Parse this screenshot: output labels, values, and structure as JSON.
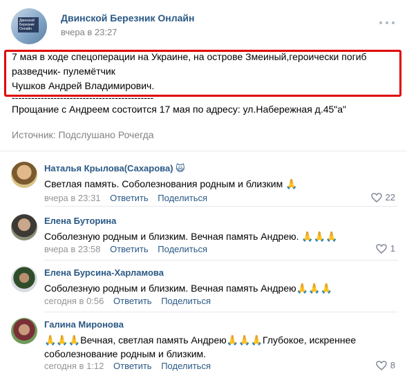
{
  "post": {
    "group_name": "Двинской Березник Онлайн",
    "time": "вчера в 23:27",
    "avatar_text": "Двинской Березник Онлайн",
    "line1": "7 мая в ходе спецоперации на Украине, на острове Змеиный,героически погиб",
    "line2": "разведчик- пулемётчик",
    "line3": "Чушков Андрей Владимирович.",
    "line4": "--------------------------------------------",
    "line5": "Прощание с Андреем состоится 17 мая по адресу: ул.Набережная д.45\"а\"",
    "source": "Источник: Подслушано Рочегда"
  },
  "actions": {
    "reply": "Ответить",
    "share": "Поделиться"
  },
  "comments": [
    {
      "name": "Наталья Крылова(Сахарова) 🙀",
      "text": "Светлая память. Соболезнования родным и близким 🙏",
      "time": "вчера в 23:31",
      "likes": "22"
    },
    {
      "name": "Елена Буторина",
      "text": "Соболезную родным и близким. Вечная память Андрею. 🙏🙏🙏",
      "time": "вчера в 23:58",
      "likes": "1"
    },
    {
      "name": "Елена Бурсина-Харламова",
      "text": "Соболезную родным и близким. Вечная память Андрею🙏🙏🙏",
      "time": "сегодня в 0:56",
      "likes": ""
    },
    {
      "name": "Галина Миронова",
      "text": "🙏🙏🙏Вечная, светлая память Андрею🙏🙏🙏Глубокое, искреннее соболезнование родным и близким.",
      "time": "сегодня в 1:12",
      "likes": "8"
    }
  ],
  "colors": {
    "link": "#2a5885",
    "meta": "#939393",
    "highlight": "#e00000"
  }
}
